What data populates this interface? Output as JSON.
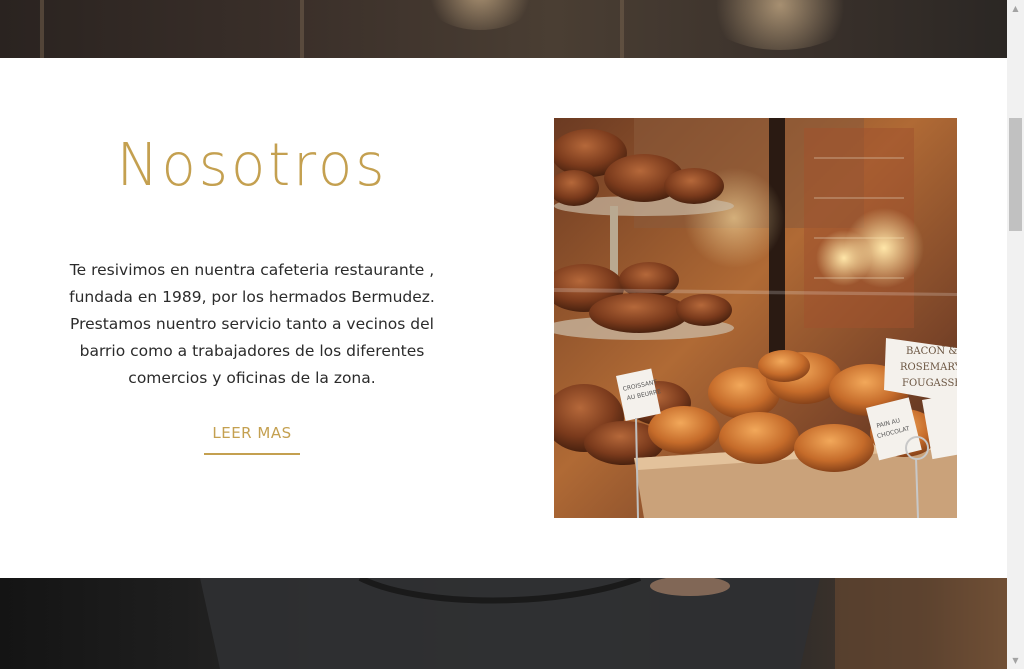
{
  "about": {
    "title": "Nosotros",
    "description": "Te resivimos en nuentra cafeteria restaurante , fundada en 1989, por los hermados Bermudez. Prestamos nuentro servicio tanto a vecinos del barrio como a trabajadores de los diferentes comercios y oficinas de la zona.",
    "button_label": "LEER MAS",
    "photo": {
      "label_bacon": "BACON &",
      "label_rosemary": "ROSEMARY",
      "label_fougasse": "FOUGASSE",
      "tag_croissant_1": "CROISSANT",
      "tag_croissant_2": "AU BEURRE",
      "tag_chocolate_1": "PAIN AU",
      "tag_chocolate_2": "CHOCOLAT"
    }
  },
  "scrollbar": {
    "up_arrow": "▲",
    "down_arrow": "▼"
  },
  "colors": {
    "accent": "#c4a050",
    "text": "#2b2b2b",
    "background": "#ffffff"
  }
}
